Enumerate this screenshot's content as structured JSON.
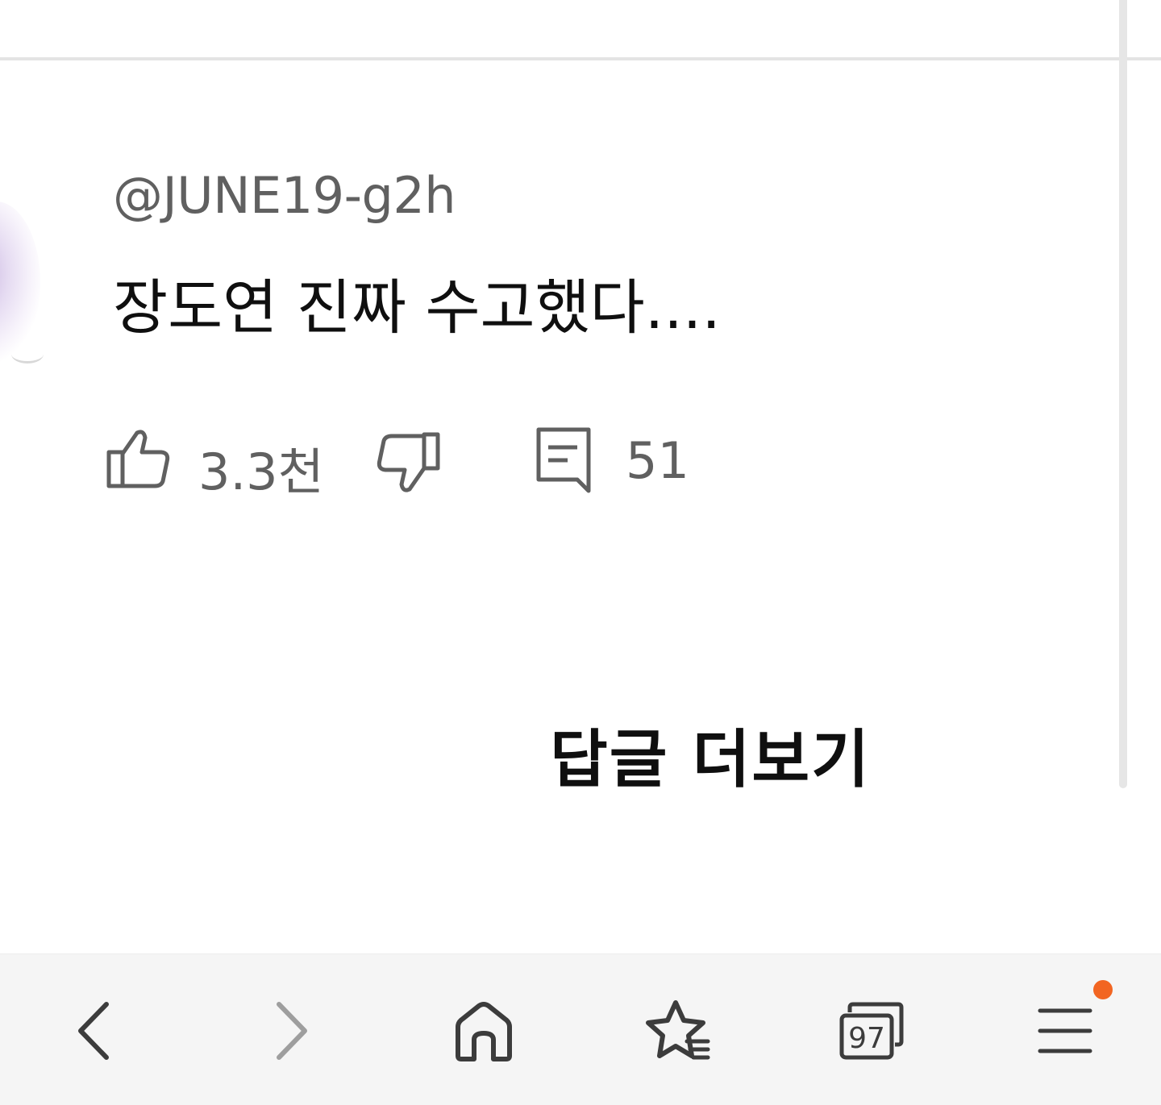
{
  "comment": {
    "username": "@JUNE19-g2h",
    "text": "장도연 진짜 수고했다....",
    "like_count": "3.3천",
    "reply_count": "51",
    "more_replies_label": "답글 더보기"
  },
  "browser_nav": {
    "back_icon": "chevron-left-icon",
    "forward_icon": "chevron-right-icon",
    "home_icon": "home-icon",
    "bookmarks_icon": "star-list-icon",
    "tabs_count": "97",
    "menu_icon": "hamburger-menu-icon",
    "menu_badge_color": "#f26522"
  },
  "colors": {
    "text_primary": "#0f0f0f",
    "text_secondary": "#606060",
    "nav_icon": "#3c3c3c",
    "nav_icon_disabled": "#9e9e9e"
  }
}
